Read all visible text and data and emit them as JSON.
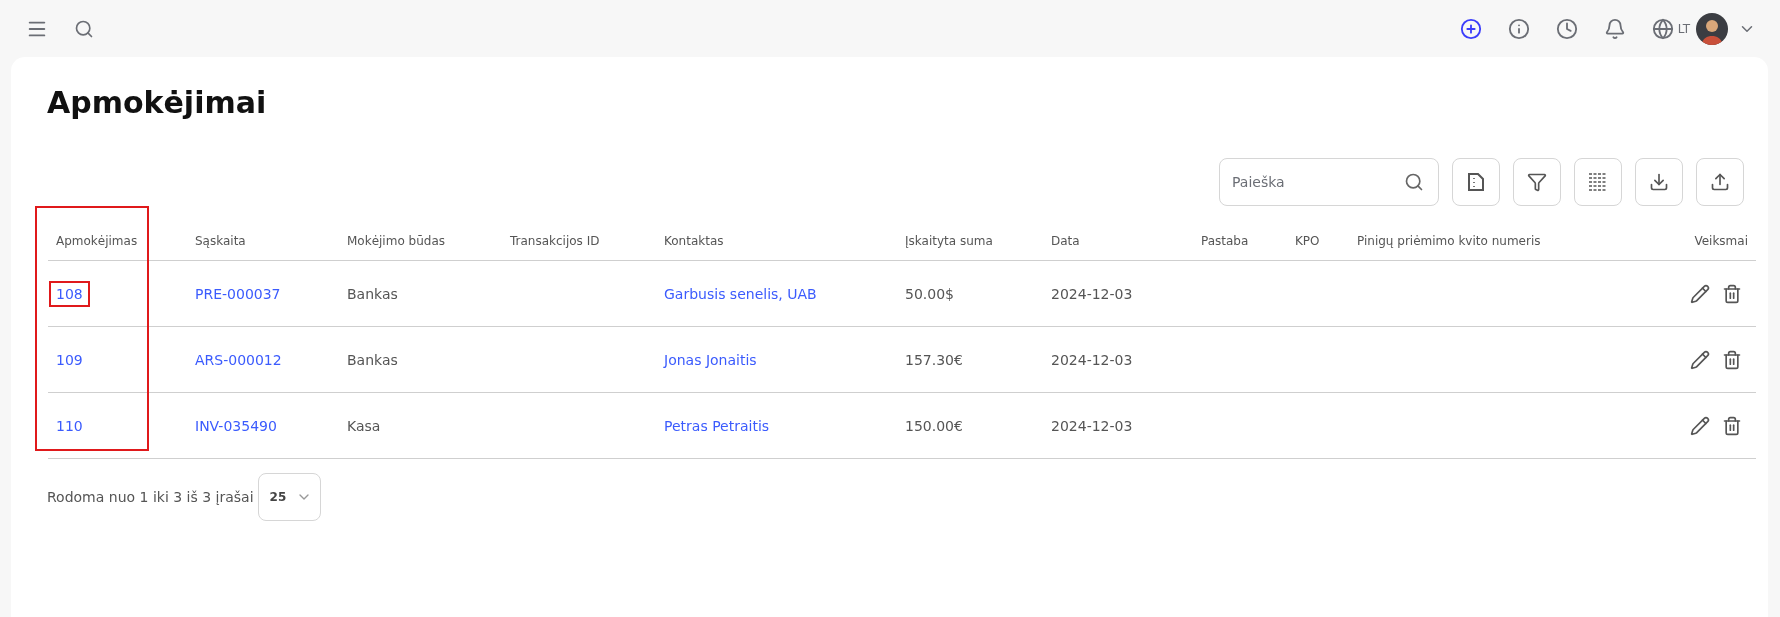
{
  "topbar": {
    "language": "LT"
  },
  "page": {
    "title": "Apmokėjimai"
  },
  "search": {
    "placeholder": "Paieška"
  },
  "table": {
    "columns": [
      {
        "label": "Apmokėjimas",
        "highlighted": true
      },
      {
        "label": "Sąskaita",
        "highlighted": false
      },
      {
        "label": "Mokėjimo būdas",
        "highlighted": false
      },
      {
        "label": "Transakcijos ID",
        "highlighted": false
      },
      {
        "label": "Kontaktas",
        "highlighted": false
      },
      {
        "label": "Įskaityta suma",
        "highlighted": false
      },
      {
        "label": "Data",
        "highlighted": false
      },
      {
        "label": "Pastaba",
        "highlighted": false
      },
      {
        "label": "KPO",
        "highlighted": false
      },
      {
        "label": "Pinigų priėmimo kvito numeris",
        "highlighted": false
      },
      {
        "label": "Veiksmai",
        "highlighted": false
      }
    ],
    "rows": [
      {
        "payment": "108",
        "payment_highlighted": true,
        "invoice": "PRE-000037",
        "method": "Bankas",
        "contact": "Garbusis senelis, UAB",
        "amount": "50.00$",
        "date": "2024-12-03"
      },
      {
        "payment": "109",
        "payment_highlighted": false,
        "invoice": "ARS-000012",
        "method": "Bankas",
        "contact": "Jonas Jonaitis",
        "amount": "157.30€",
        "date": "2024-12-03"
      },
      {
        "payment": "110",
        "payment_highlighted": false,
        "invoice": "INV-035490",
        "method": "Kasa",
        "contact": "Petras Petraitis",
        "amount": "150.00€",
        "date": "2024-12-03"
      }
    ]
  },
  "pagination": {
    "summary": "Rodoma nuo 1 iki 3 iš 3 įrašai",
    "page_size": "25"
  }
}
